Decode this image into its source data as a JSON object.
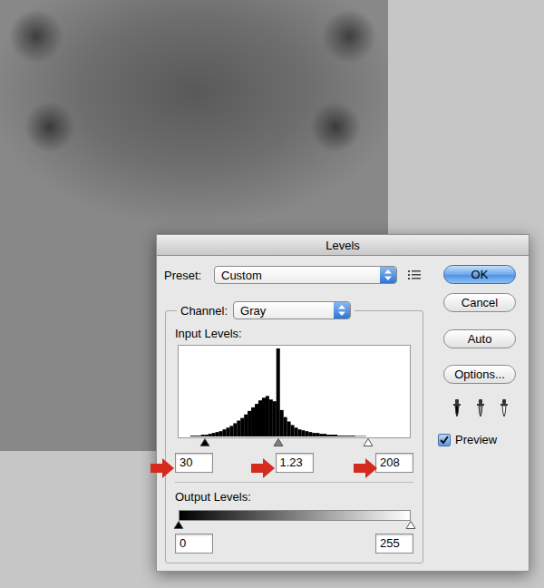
{
  "window": {
    "title": "Levels"
  },
  "preset": {
    "label": "Preset:",
    "value": "Custom"
  },
  "channel": {
    "label": "Channel:",
    "value": "Gray"
  },
  "input_levels": {
    "label": "Input Levels:",
    "values": [
      "30",
      "1.23",
      "208"
    ],
    "sliders": [
      {
        "name": "black",
        "level": 0.118,
        "color": "#000000"
      },
      {
        "name": "gray",
        "level": 0.43,
        "color": "#808080"
      },
      {
        "name": "white",
        "level": 0.816,
        "color": "#ffffff"
      }
    ]
  },
  "histogram": {
    "values": [
      0,
      0,
      0,
      1,
      1,
      1,
      2,
      2,
      3,
      4,
      5,
      6,
      8,
      10,
      12,
      15,
      18,
      21,
      25,
      29,
      33,
      37,
      41,
      44,
      46,
      42,
      40,
      100,
      30,
      22,
      17,
      13,
      10,
      8,
      7,
      6,
      5,
      4,
      4,
      3,
      3,
      2,
      2,
      2,
      1,
      1,
      1,
      1,
      1,
      0.5,
      0.5,
      0.5,
      0,
      0,
      0,
      0,
      0,
      0,
      0,
      0,
      0,
      0,
      0,
      0
    ]
  },
  "output_levels": {
    "label": "Output Levels:",
    "values": [
      "0",
      "255"
    ],
    "sliders": [
      {
        "name": "black",
        "level": 0,
        "color": "#000000"
      },
      {
        "name": "white",
        "level": 1,
        "color": "#ffffff"
      }
    ]
  },
  "buttons": [
    {
      "label": "OK",
      "default": true
    },
    {
      "label": "Cancel",
      "default": false
    },
    {
      "label": "Auto",
      "default": false
    },
    {
      "label": "Options...",
      "default": false
    }
  ],
  "eyedroppers": [
    {
      "name": "black",
      "color": "#000000"
    },
    {
      "name": "gray",
      "color": "#9a9a9a"
    },
    {
      "name": "white",
      "color": "#ffffff"
    }
  ],
  "preview": {
    "label": "Preview",
    "checked": true
  }
}
